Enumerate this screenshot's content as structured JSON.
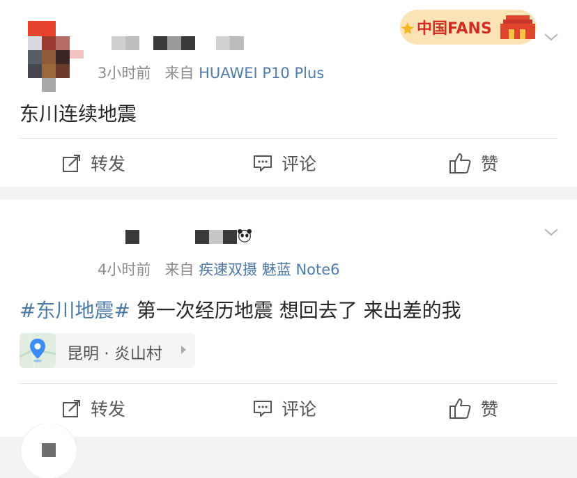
{
  "posts": [
    {
      "time": "3小时前",
      "from_prefix": "来自",
      "source": "HUAWEI P10 Plus",
      "text": "东川连续地震",
      "badge_text": "中国FANS",
      "actions": {
        "repost": "转发",
        "comment": "评论",
        "like": "赞"
      }
    },
    {
      "time": "4小时前",
      "from_prefix": "来自",
      "source": "疾速双摄 魅蓝 Note6",
      "topic": "#东川地震#",
      "text": " 第一次经历地震 想回去了 来出差的我",
      "location": "昆明 · 炎山村",
      "actions": {
        "repost": "转发",
        "comment": "评论",
        "like": "赞"
      }
    }
  ],
  "colors": {
    "link": "#4e7aa6",
    "meta": "#8c8c8c",
    "background": "#f2f2f2"
  },
  "icons": [
    "chevron-down-icon",
    "repost-icon",
    "comment-icon",
    "like-icon",
    "location-pin-icon",
    "panda-icon"
  ]
}
